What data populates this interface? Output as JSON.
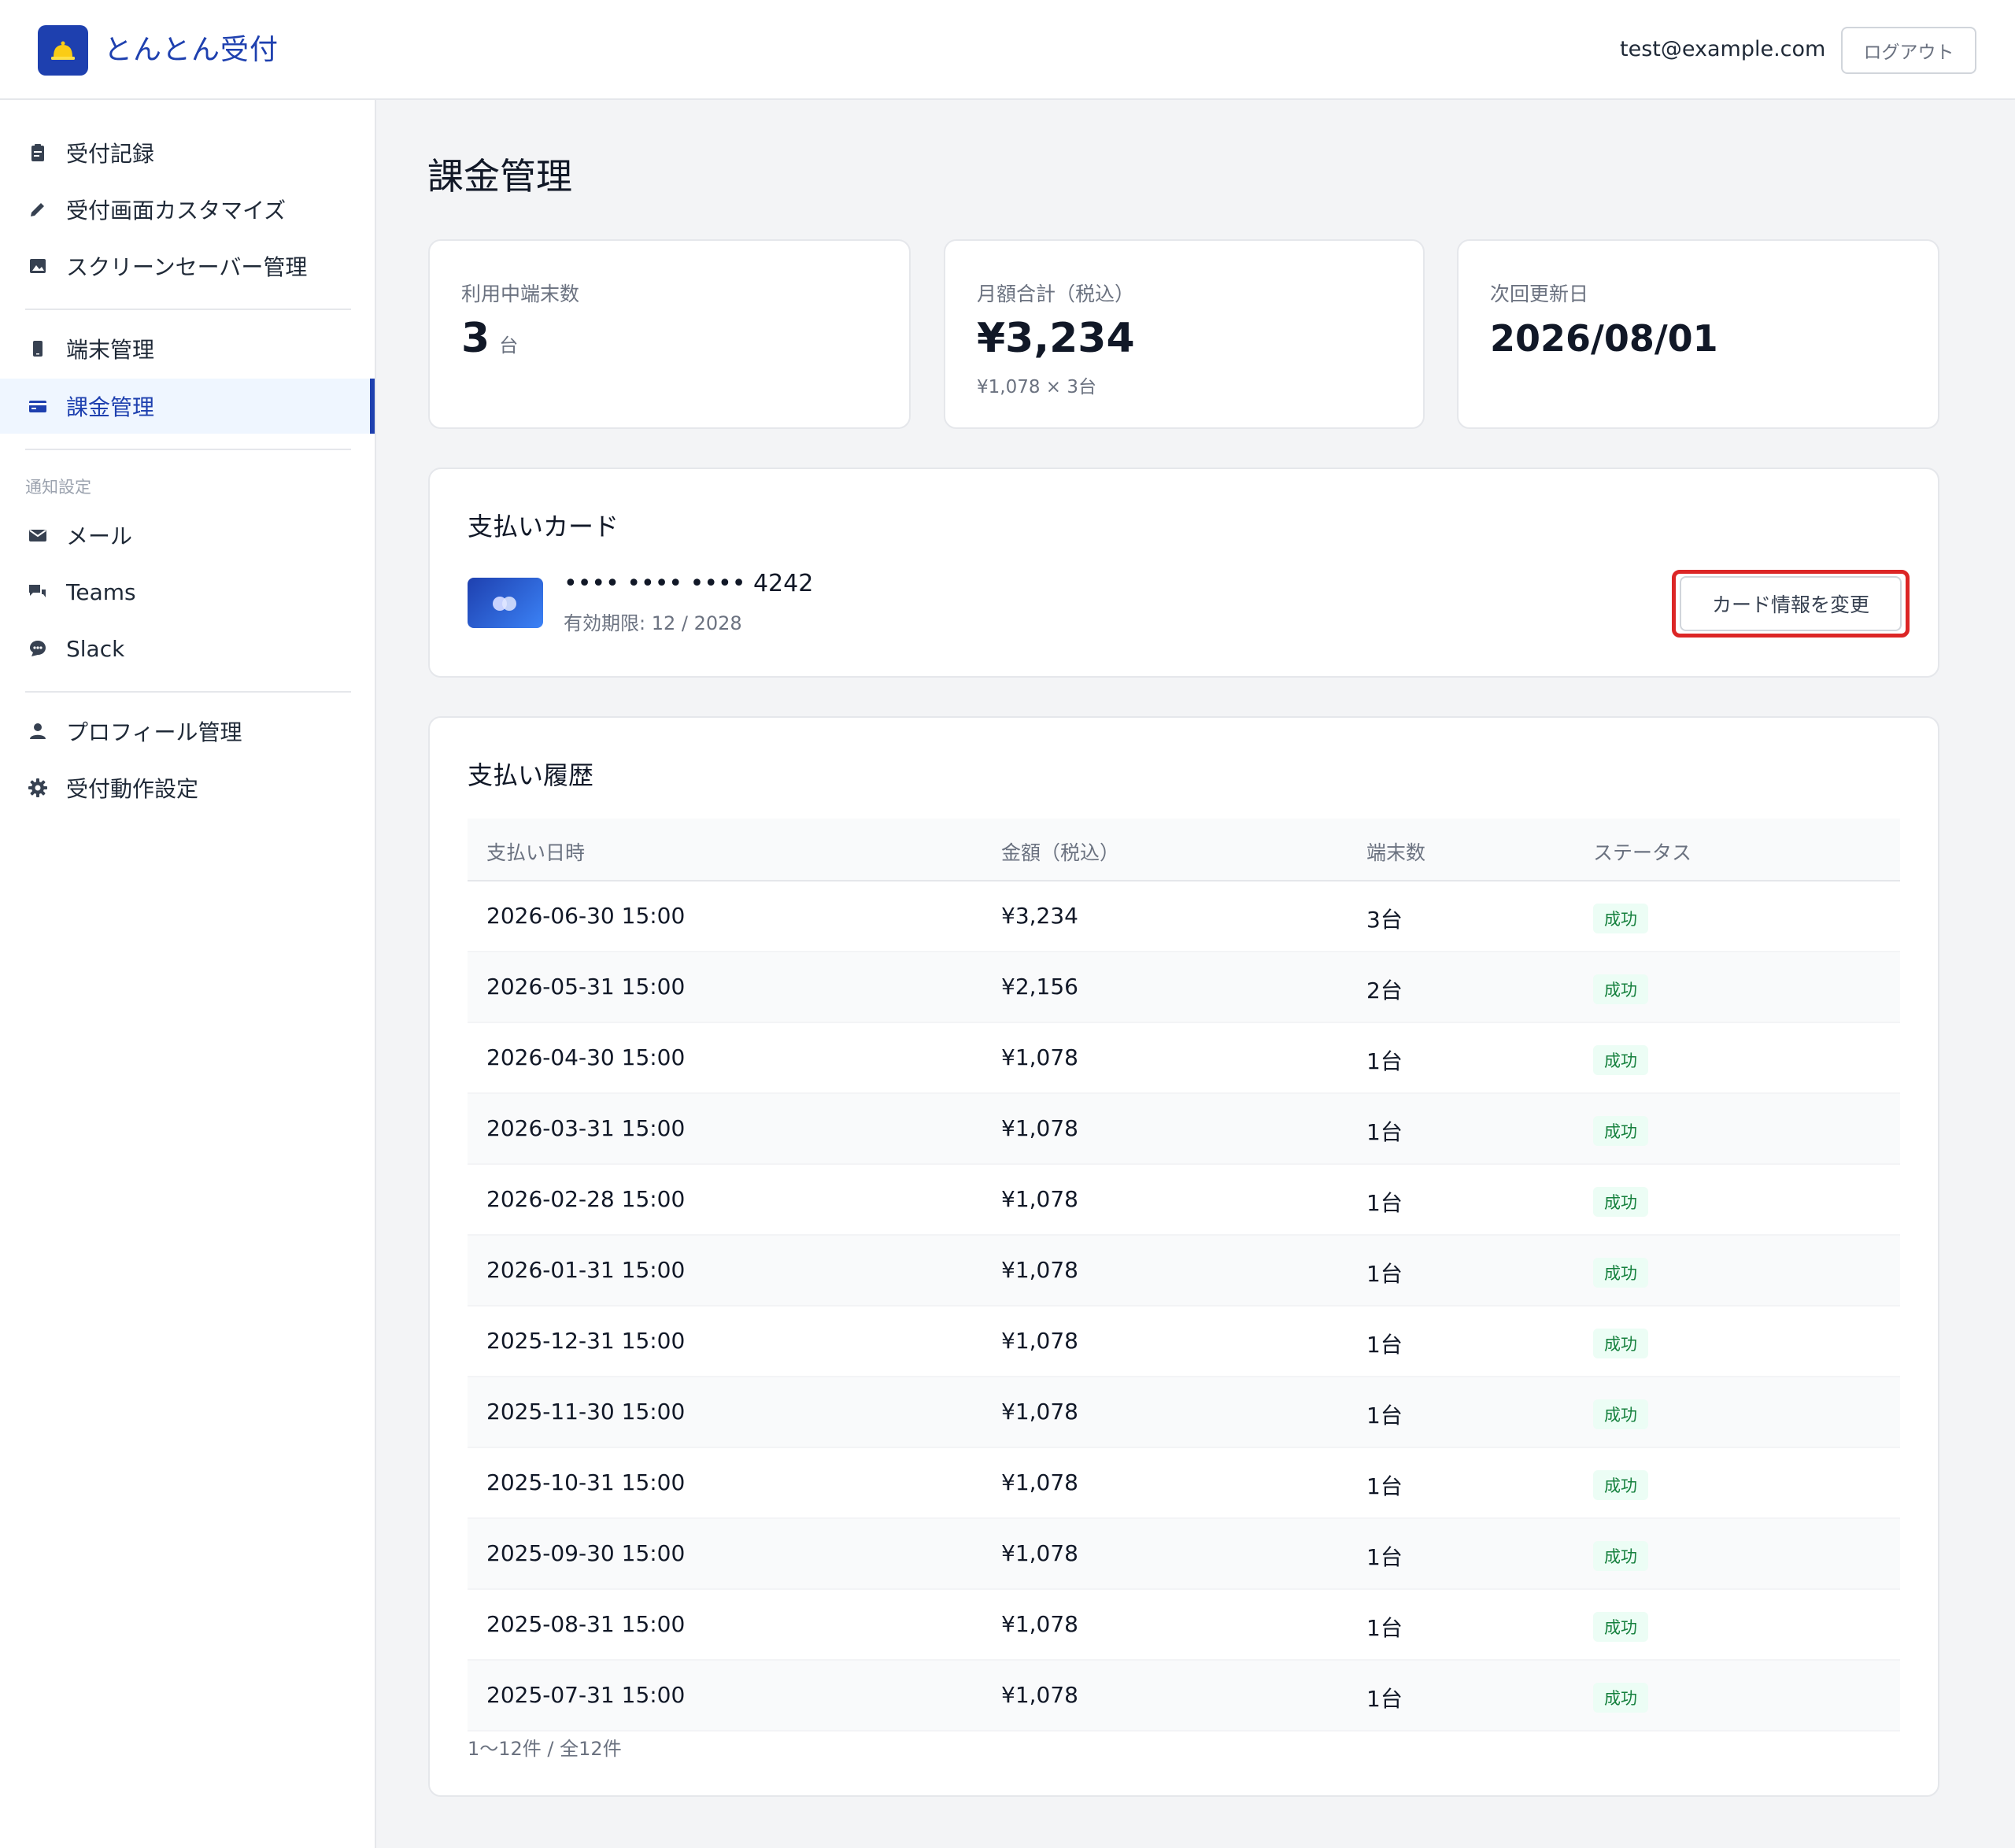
{
  "header": {
    "app_title": "とんとん受付",
    "user_email": "test@example.com",
    "logout_label": "ログアウト"
  },
  "sidebar": {
    "group1": [
      {
        "label": "受付記録",
        "icon": "clipboard-icon"
      },
      {
        "label": "受付画面カスタマイズ",
        "icon": "pencil-icon"
      },
      {
        "label": "スクリーンセーバー管理",
        "icon": "image-icon"
      }
    ],
    "group2": [
      {
        "label": "端末管理",
        "icon": "device-icon"
      },
      {
        "label": "課金管理",
        "icon": "credit-card-icon",
        "active": true
      }
    ],
    "section_label": "通知設定",
    "group3": [
      {
        "label": "メール",
        "icon": "mail-icon"
      },
      {
        "label": "Teams",
        "icon": "chat-icon"
      },
      {
        "label": "Slack",
        "icon": "message-icon"
      }
    ],
    "group4": [
      {
        "label": "プロフィール管理",
        "icon": "person-icon"
      },
      {
        "label": "受付動作設定",
        "icon": "gear-icon"
      }
    ]
  },
  "page_title": "課金管理",
  "stats": [
    {
      "label": "利用中端末数",
      "value": "3",
      "unit": "台",
      "sub": ""
    },
    {
      "label": "月額合計（税込）",
      "value": "¥3,234",
      "unit": "",
      "sub": "¥1,078 × 3台"
    },
    {
      "label": "次回更新日",
      "value": "2026/08/01",
      "unit": "",
      "sub": ""
    }
  ],
  "payment_card": {
    "title": "支払いカード",
    "number": "•••• •••• •••• 4242",
    "expiry": "有効期限: 12 / 2028",
    "change_label": "カード情報を変更"
  },
  "history": {
    "title": "支払い履歴",
    "columns": [
      "支払い日時",
      "金額（税込）",
      "端末数",
      "ステータス"
    ],
    "rows": [
      {
        "date": "2026-06-30 15:00",
        "amount": "¥3,234",
        "devices": "3台",
        "status": "成功"
      },
      {
        "date": "2026-05-31 15:00",
        "amount": "¥2,156",
        "devices": "2台",
        "status": "成功"
      },
      {
        "date": "2026-04-30 15:00",
        "amount": "¥1,078",
        "devices": "1台",
        "status": "成功"
      },
      {
        "date": "2026-03-31 15:00",
        "amount": "¥1,078",
        "devices": "1台",
        "status": "成功"
      },
      {
        "date": "2026-02-28 15:00",
        "amount": "¥1,078",
        "devices": "1台",
        "status": "成功"
      },
      {
        "date": "2026-01-31 15:00",
        "amount": "¥1,078",
        "devices": "1台",
        "status": "成功"
      },
      {
        "date": "2025-12-31 15:00",
        "amount": "¥1,078",
        "devices": "1台",
        "status": "成功"
      },
      {
        "date": "2025-11-30 15:00",
        "amount": "¥1,078",
        "devices": "1台",
        "status": "成功"
      },
      {
        "date": "2025-10-31 15:00",
        "amount": "¥1,078",
        "devices": "1台",
        "status": "成功"
      },
      {
        "date": "2025-09-30 15:00",
        "amount": "¥1,078",
        "devices": "1台",
        "status": "成功"
      },
      {
        "date": "2025-08-31 15:00",
        "amount": "¥1,078",
        "devices": "1台",
        "status": "成功"
      },
      {
        "date": "2025-07-31 15:00",
        "amount": "¥1,078",
        "devices": "1台",
        "status": "成功"
      }
    ],
    "footer": "1〜12件 / 全12件"
  },
  "colors": {
    "brand": "#1e40af",
    "success_bg": "#ecfdf5",
    "success_text": "#15803d",
    "highlight": "#dc2626"
  }
}
